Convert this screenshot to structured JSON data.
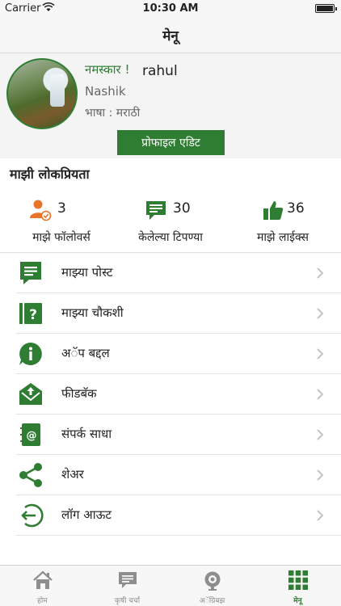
{
  "status_bar": {
    "carrier": "Carrier",
    "time": "10:30 AM"
  },
  "nav": {
    "title": "मेनू"
  },
  "profile": {
    "greeting": "नमस्कार !",
    "name": "rahul",
    "location": "Nashik",
    "language": "भाषा : मराठी",
    "edit_label": "प्रोफाइल एडिट"
  },
  "popularity": {
    "title": "माझी लोकप्रियता",
    "followers": {
      "count": "3",
      "label": "माझे फॉलोवर्स"
    },
    "comments": {
      "count": "30",
      "label": "केलेल्या टिपण्या"
    },
    "likes": {
      "count": "36",
      "label": "माझे लाईक्स"
    }
  },
  "menu": {
    "items": [
      {
        "label": "माझ्या पोस्ट",
        "icon": "post-icon"
      },
      {
        "label": "माझ्या चौकशी",
        "icon": "question-icon"
      },
      {
        "label": "अॅप बद्दल",
        "icon": "info-icon"
      },
      {
        "label": "फीडबॅक",
        "icon": "feedback-icon"
      },
      {
        "label": "संपर्क साधा",
        "icon": "contact-icon"
      },
      {
        "label": "शेअर",
        "icon": "share-icon"
      },
      {
        "label": "लॉग आऊट",
        "icon": "logout-icon"
      }
    ]
  },
  "tabs": [
    {
      "label": "होम",
      "icon": "home-icon"
    },
    {
      "label": "कृषी चर्चा",
      "icon": "discussion-icon"
    },
    {
      "label": "अॅग्रिबझ",
      "icon": "agribuzz-icon"
    },
    {
      "label": "मेनू",
      "icon": "grid-icon",
      "active": true
    }
  ],
  "colors": {
    "accent": "#2e7d32",
    "followers_icon": "#e8742b",
    "tab_inactive": "#8e8e8e"
  }
}
